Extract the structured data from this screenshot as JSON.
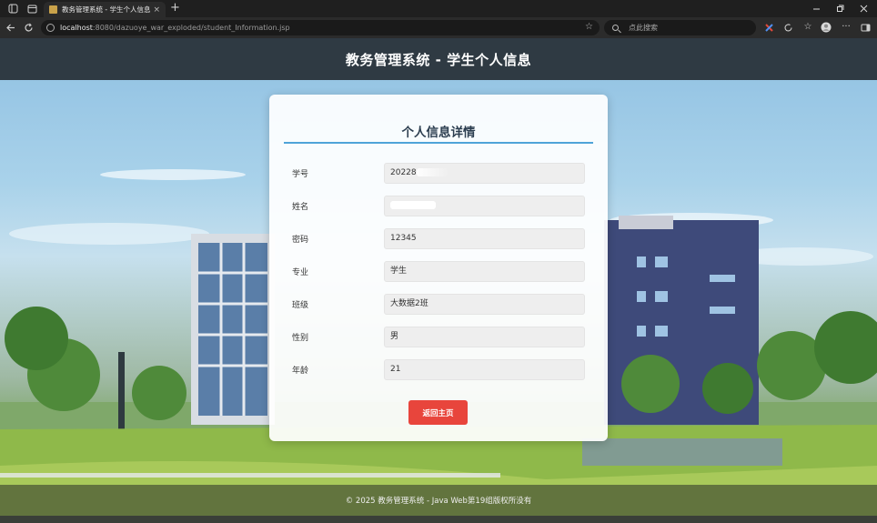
{
  "browser": {
    "tab_title": "教务管理系统 - 学生个人信息",
    "tab_close": "×",
    "new_tab": "+",
    "url_host": "localhost",
    "url_rest": ":8080/dazuoye_war_exploded/student_Information.jsp",
    "search_placeholder": "点此搜索",
    "icons": [
      "sidebar-icon",
      "tabs-icon",
      "back-icon",
      "reload-icon",
      "info-icon",
      "star-icon",
      "search-icon",
      "extension-icon",
      "refresh-icon",
      "favorites-icon",
      "profile-icon",
      "more-icon",
      "sidebar-toggle-icon"
    ]
  },
  "header": {
    "title": "教务管理系统 - 学生个人信息"
  },
  "card": {
    "title": "个人信息详情",
    "fields": [
      {
        "label": "学号",
        "value": "20228"
      },
      {
        "label": "姓名",
        "value": ""
      },
      {
        "label": "密码",
        "value": "12345"
      },
      {
        "label": "专业",
        "value": "学生"
      },
      {
        "label": "班级",
        "value": "大数据2班"
      },
      {
        "label": "性别",
        "value": "男"
      },
      {
        "label": "年龄",
        "value": "21"
      }
    ],
    "back_button": "返回主页"
  },
  "footer": {
    "text": "© 2025 教务管理系统 - Java Web第19组版权所没有"
  },
  "colors": {
    "header_bg": "#2f3a43",
    "accent_rule": "#4fa3d8",
    "button": "#e8453c"
  }
}
